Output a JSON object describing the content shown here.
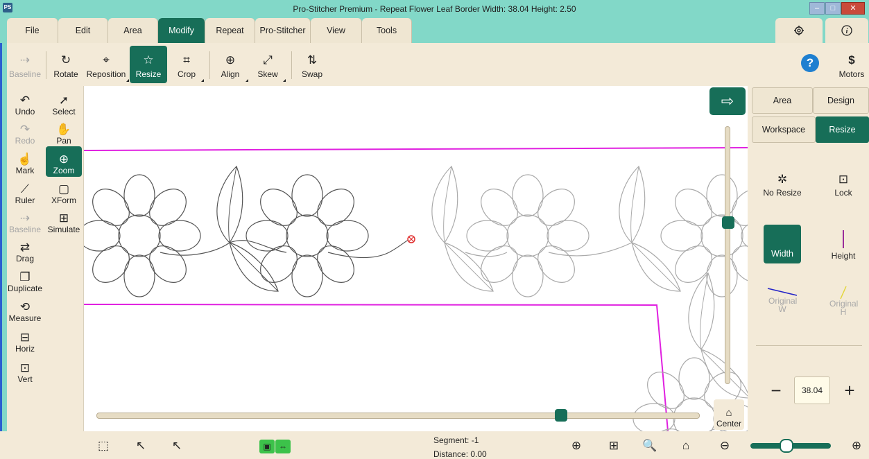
{
  "window": {
    "title": "Pro-Stitcher Premium  -  Repeat Flower Leaf Border  Width: 38.04   Height: 2.50",
    "app_icon": "PS",
    "controls": {
      "minimize": "–",
      "maximize": "□",
      "close": "✕"
    }
  },
  "menu": {
    "tabs": [
      {
        "label": "File",
        "active": false
      },
      {
        "label": "Edit",
        "active": false
      },
      {
        "label": "Area",
        "active": false
      },
      {
        "label": "Modify",
        "active": true
      },
      {
        "label": "Repeat",
        "active": false
      },
      {
        "label": "Pro-Stitcher",
        "active": false
      },
      {
        "label": "View",
        "active": false
      },
      {
        "label": "Tools",
        "active": false
      }
    ],
    "settings_icon": "gear-icon",
    "info_icon": "info-icon"
  },
  "toolbar": {
    "items": [
      {
        "label": "Baseline",
        "icon": "baseline-icon",
        "state": "disabled"
      },
      {
        "label": "Rotate",
        "icon": "rotate-icon",
        "state": "normal"
      },
      {
        "label": "Reposition",
        "icon": "reposition-icon",
        "state": "normal"
      },
      {
        "label": "Resize",
        "icon": "resize-icon",
        "state": "active"
      },
      {
        "label": "Crop",
        "icon": "crop-icon",
        "state": "normal"
      },
      {
        "label": "Align",
        "icon": "align-icon",
        "state": "normal"
      },
      {
        "label": "Skew",
        "icon": "skew-icon",
        "state": "normal"
      },
      {
        "label": "Swap",
        "icon": "swap-icon",
        "state": "normal"
      }
    ],
    "help_icon": "help-icon",
    "motors_label": "Motors"
  },
  "left_tools": [
    {
      "label": "Undo",
      "icon": "undo-icon",
      "state": "normal"
    },
    {
      "label": "Select",
      "icon": "select-icon",
      "state": "normal"
    },
    {
      "label": "Redo",
      "icon": "redo-icon",
      "state": "disabled"
    },
    {
      "label": "Pan",
      "icon": "pan-icon",
      "state": "normal"
    },
    {
      "label": "Mark",
      "icon": "mark-icon",
      "state": "normal"
    },
    {
      "label": "Zoom",
      "icon": "zoom-icon",
      "state": "active"
    },
    {
      "label": "Ruler",
      "icon": "ruler-icon",
      "state": "normal"
    },
    {
      "label": "XForm",
      "icon": "xform-icon",
      "state": "normal"
    },
    {
      "label": "Baseline",
      "icon": "baseline-icon",
      "state": "disabled"
    },
    {
      "label": "Simulate",
      "icon": "simulate-icon",
      "state": "normal"
    },
    {
      "label": "Drag",
      "icon": "drag-icon",
      "state": "normal"
    },
    {
      "label": "Duplicate",
      "icon": "duplicate-icon",
      "state": "normal"
    },
    {
      "label": "Measure",
      "icon": "measure-icon",
      "state": "normal"
    },
    {
      "label": "Horiz",
      "icon": "horiz-lock-icon",
      "state": "normal"
    },
    {
      "label": "Vert",
      "icon": "vert-lock-icon",
      "state": "normal"
    }
  ],
  "right_panel": {
    "tabs_row1": [
      {
        "label": "Area",
        "active": false
      },
      {
        "label": "Design",
        "active": false
      }
    ],
    "tabs_row2": [
      {
        "label": "Workspace",
        "active": false
      },
      {
        "label": "Resize",
        "active": true
      }
    ],
    "options": {
      "no_resize": "No Resize",
      "lock": "Lock",
      "width": "Width",
      "height": "Height",
      "original_w": "Original W",
      "original_h": "Original H"
    },
    "value": "38.04",
    "minus": "−",
    "plus": "+"
  },
  "canvas": {
    "center_label": "Center",
    "arrow_icon": "arrow-right-icon"
  },
  "status": {
    "segment_label": "Segment:",
    "segment_value": "-1",
    "distance_label": "Distance:",
    "distance_value": "0.00"
  },
  "colors": {
    "accent": "#176e58",
    "titlebar": "#82d8c8",
    "panel_bg": "#f3ead8",
    "boundary": "#e020e0",
    "stitch": "#555555"
  }
}
